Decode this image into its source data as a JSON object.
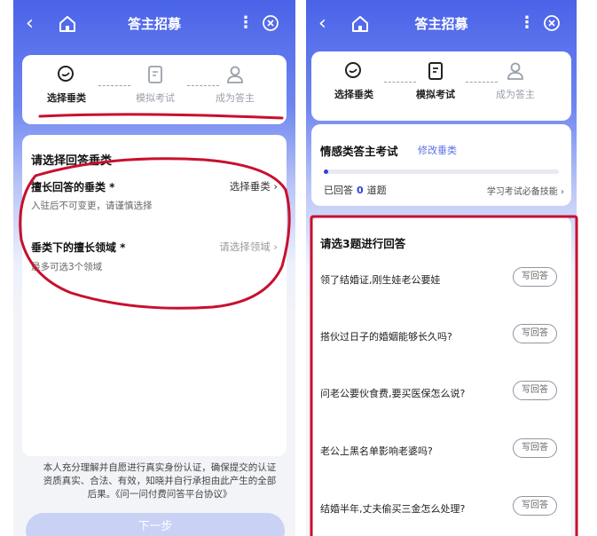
{
  "left": {
    "nav": {
      "title": "答主招募"
    },
    "steps": [
      {
        "label": "选择垂类",
        "icon": "chat-search-icon",
        "active": true
      },
      {
        "label": "模拟考试",
        "icon": "document-icon",
        "active": false
      },
      {
        "label": "成为答主",
        "icon": "person-icon",
        "active": false
      }
    ],
    "form": {
      "title": "请选择回答垂类",
      "field1": {
        "label": "擅长回答的垂类 *",
        "value": "选择垂类",
        "hint": "入驻后不可变更，请谨慎选择"
      },
      "field2": {
        "label": "垂类下的擅长领域 *",
        "value": "请选择领域",
        "hint": "最多可选3个领域"
      }
    },
    "agreement": "本人充分理解并自愿进行真实身份认证，确保提交的认证资质真实、合法、有效，知晓并自行承担由此产生的全部后果。《问一问付费问答平台协议》",
    "next_label": "下一步"
  },
  "right": {
    "nav": {
      "title": "答主招募"
    },
    "steps": [
      {
        "label": "选择垂类",
        "icon": "chat-search-icon",
        "active": true
      },
      {
        "label": "模拟考试",
        "icon": "document-icon",
        "active": true
      },
      {
        "label": "成为答主",
        "icon": "person-icon",
        "active": false
      }
    ],
    "exam": {
      "title": "情感类答主考试",
      "edit_label": "修改垂类",
      "progress_fraction": 0.02,
      "answered_prefix": "已回答",
      "answered_count": "0",
      "answered_suffix": "道题",
      "tips_label": "学习考试必备技能"
    },
    "questions_heading": "请选3题进行回答",
    "write_label": "写回答",
    "questions": [
      "领了结婚证,刚生娃老公要娃",
      "搭伙过日子的婚姻能够长久吗?",
      "问老公要伙食费,要买医保怎么说?",
      "老公上黑名单影响老婆吗?",
      "结婚半年,丈夫偷买三金怎么处理?"
    ]
  },
  "colors": {
    "primary": "#4a63e8",
    "accent_blue": "#2d44d6",
    "annotation_red": "#c8102e"
  }
}
